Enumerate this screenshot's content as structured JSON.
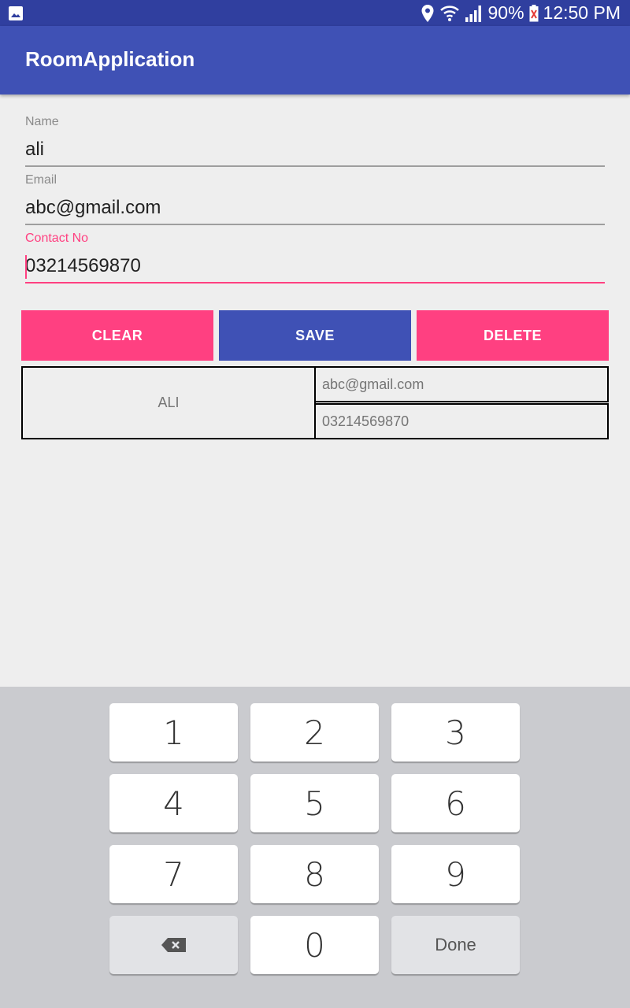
{
  "status_bar": {
    "battery_percent": "90%",
    "time": "12:50 PM",
    "icons": [
      "gallery-icon",
      "location-icon",
      "wifi-icon",
      "signal-icon",
      "battery-icon"
    ]
  },
  "app": {
    "title": "RoomApplication"
  },
  "form": {
    "name": {
      "label": "Name",
      "value": "ali"
    },
    "email": {
      "label": "Email",
      "value": "abc@gmail.com"
    },
    "contact": {
      "label": "Contact No",
      "value": "03214569870"
    }
  },
  "buttons": {
    "clear": "CLEAR",
    "save": "SAVE",
    "delete": "DELETE"
  },
  "record": {
    "name": "ALI",
    "email": "abc@gmail.com",
    "phone": "03214569870"
  },
  "keyboard": {
    "keys": [
      "1",
      "2",
      "3",
      "4",
      "5",
      "6",
      "7",
      "8",
      "9",
      "0"
    ],
    "done_label": "Done",
    "backspace_icon": "backspace-icon"
  },
  "colors": {
    "primary": "#3f51b5",
    "primary_dark": "#303f9f",
    "accent": "#ff4081"
  }
}
